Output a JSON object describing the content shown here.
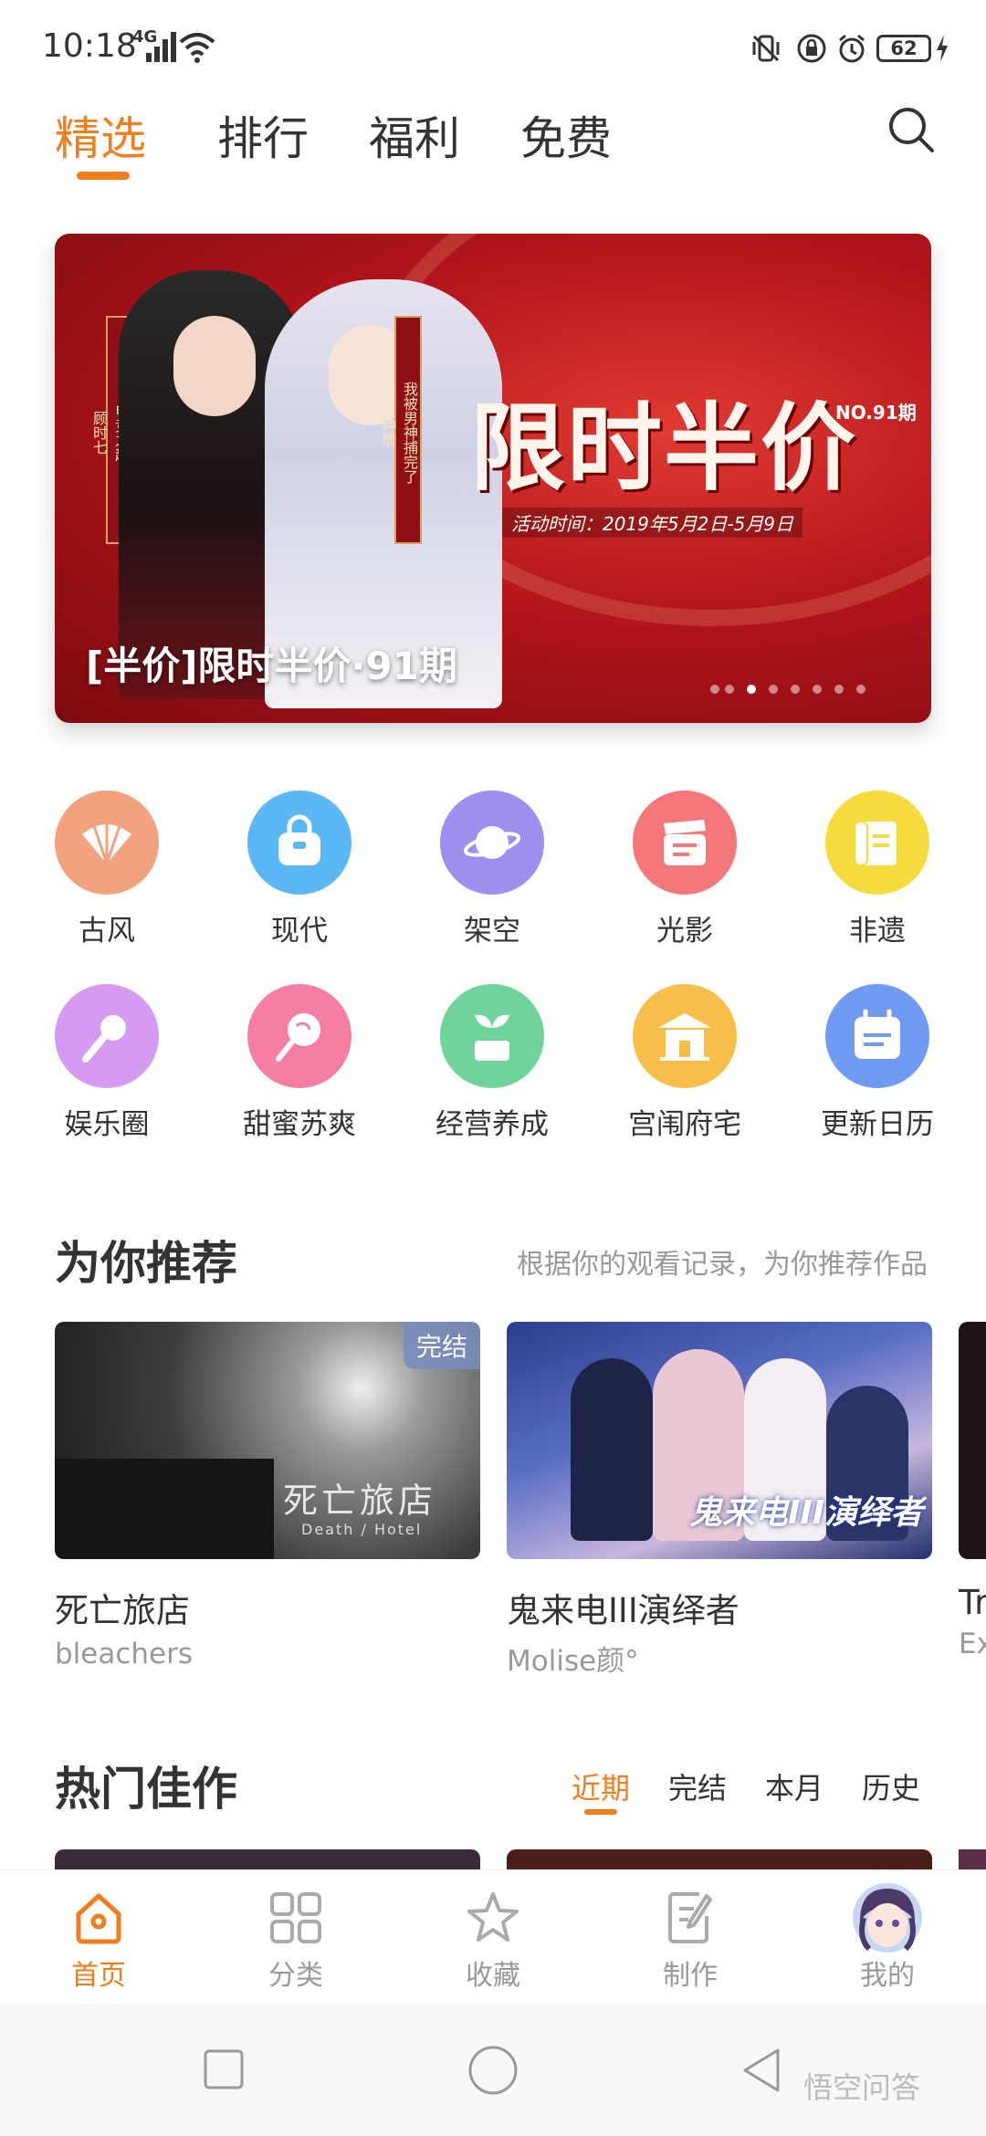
{
  "status_bar": {
    "time": "10:18",
    "network": "4G",
    "battery": "62"
  },
  "top_tabs": [
    {
      "label": "精选",
      "active": true
    },
    {
      "label": "排行",
      "active": false
    },
    {
      "label": "福利",
      "active": false
    },
    {
      "label": "免费",
      "active": false
    }
  ],
  "banner": {
    "headline": "限时半价",
    "issue": "NO.91期",
    "subtitle": "活动时间：2019年5月2日-5月9日",
    "tag_left": "电竞之超",
    "tag_left_sub": "顾时七",
    "tag_right": "我被男神捕完了",
    "tag_right_sub": "钟情",
    "caption": "[半价]限时半价·91期"
  },
  "categories": [
    {
      "label": "古风",
      "icon": "fan-icon",
      "color": "#f3a27e"
    },
    {
      "label": "现代",
      "icon": "handbag-icon",
      "color": "#5bb7f5"
    },
    {
      "label": "架空",
      "icon": "planet-icon",
      "color": "#9c8ff0"
    },
    {
      "label": "光影",
      "icon": "clapperboard-icon",
      "color": "#f5777a"
    },
    {
      "label": "非遗",
      "icon": "scroll-icon",
      "color": "#f5dc3c"
    },
    {
      "label": "娱乐圈",
      "icon": "microphone-icon",
      "color": "#d59af1"
    },
    {
      "label": "甜蜜苏爽",
      "icon": "lollipop-icon",
      "color": "#f57ea2"
    },
    {
      "label": "经营养成",
      "icon": "sprout-icon",
      "color": "#6ed49a"
    },
    {
      "label": "宫闱府宅",
      "icon": "palace-icon",
      "color": "#f7be4a"
    },
    {
      "label": "更新日历",
      "icon": "calendar-icon",
      "color": "#6f9cf2"
    }
  ],
  "recommend": {
    "title": "为你推荐",
    "hint": "根据你的观看记录，为你推荐作品",
    "cards": [
      {
        "title": "死亡旅店",
        "author": "bleachers",
        "badge": "完结",
        "cover_text": "死亡旅店",
        "cover_sub": "Death / Hotel"
      },
      {
        "title": "鬼来电III演绎者",
        "author": "Molise颜°",
        "cover_text": "鬼来电III演绎者"
      },
      {
        "title": "Tr",
        "author": "Ex"
      }
    ]
  },
  "hot": {
    "title": "热门佳作",
    "tabs": [
      {
        "label": "近期",
        "active": true
      },
      {
        "label": "完结",
        "active": false
      },
      {
        "label": "本月",
        "active": false
      },
      {
        "label": "历史",
        "active": false
      }
    ]
  },
  "bottom_nav": [
    {
      "label": "首页",
      "icon": "home-icon",
      "active": true
    },
    {
      "label": "分类",
      "icon": "grid-icon",
      "active": false
    },
    {
      "label": "收藏",
      "icon": "star-icon",
      "active": false
    },
    {
      "label": "制作",
      "icon": "edit-icon",
      "active": false
    },
    {
      "label": "我的",
      "icon": "avatar-icon",
      "active": false
    }
  ],
  "watermark": "悟空问答",
  "colors": {
    "accent": "#f07d1e",
    "text": "#333333",
    "muted": "#999999"
  }
}
